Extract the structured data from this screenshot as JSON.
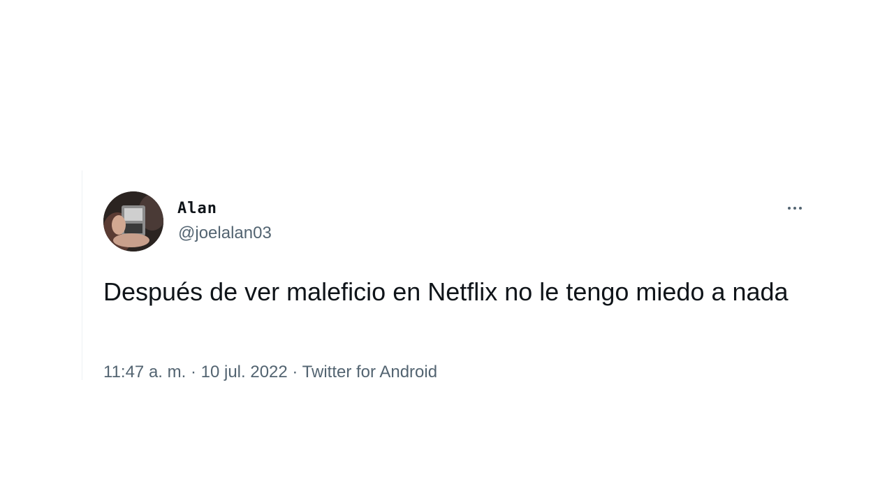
{
  "tweet": {
    "author": {
      "display_name": "Alan",
      "handle": "@joelalan03",
      "avatar_icon": "user-avatar-photo"
    },
    "more_icon": "more-options-icon",
    "text": "Después de ver maleficio en Netflix no le tengo miedo a nada",
    "meta": {
      "time": "11:47 a. m.",
      "separator": "·",
      "date": "10 jul. 2022",
      "source": "Twitter for Android"
    }
  },
  "colors": {
    "text_primary": "#0f1419",
    "text_secondary": "#536471",
    "background": "#ffffff"
  }
}
